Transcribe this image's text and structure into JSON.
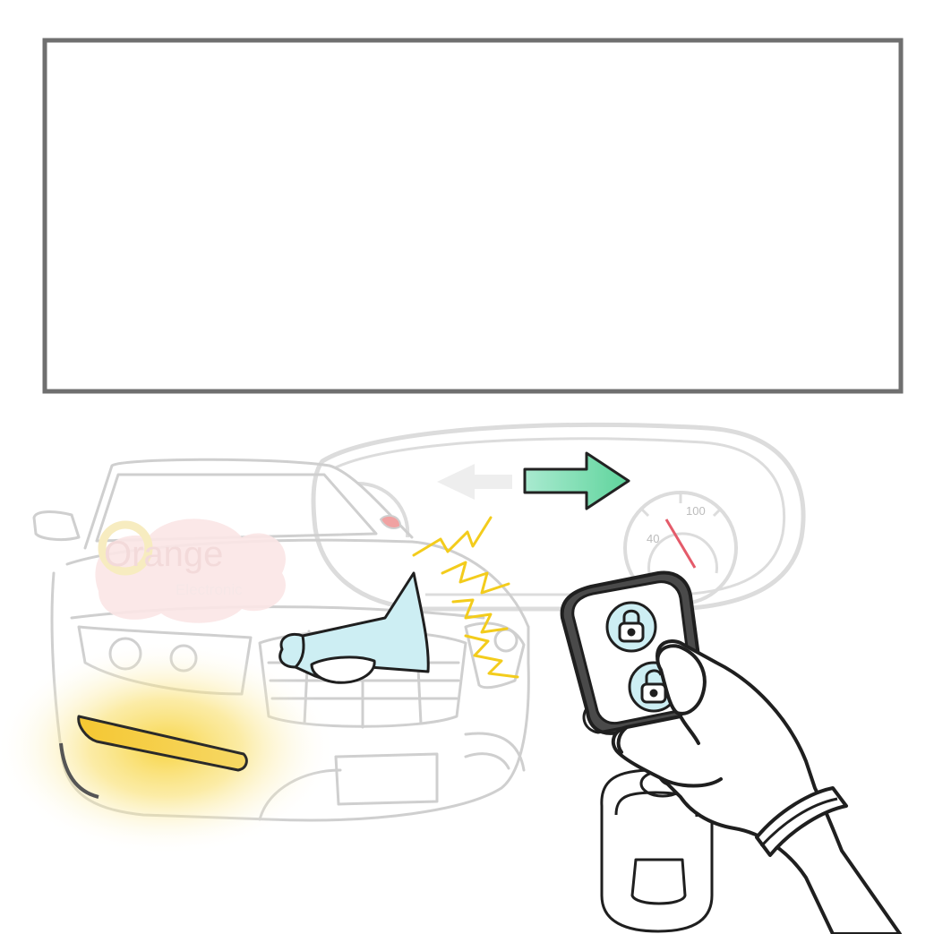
{
  "text_box": {
    "content": ""
  },
  "logo": {
    "brand": "Orange",
    "tagline": "Electronic",
    "colors": {
      "wordmark": "#f3dada",
      "initial": "#f7ecc0",
      "cloud": "#fbe6e6"
    }
  },
  "dashboard": {
    "speedometer_labels": [
      "40",
      "100"
    ],
    "needle_color": "#e45b6a"
  },
  "signal": {
    "direction": "right",
    "active_arrow_color": "#6fd9a6",
    "inactive_arrow_color": "#eeeeee"
  },
  "remote": {
    "buttons": [
      "lock-icon",
      "unlock-icon"
    ],
    "button_color": "#cdeef3"
  },
  "car": {
    "turn_signal_color": "#f5d24a",
    "horn_color": "#cdeef3",
    "sound_burst_color": "#f3cc1c"
  }
}
